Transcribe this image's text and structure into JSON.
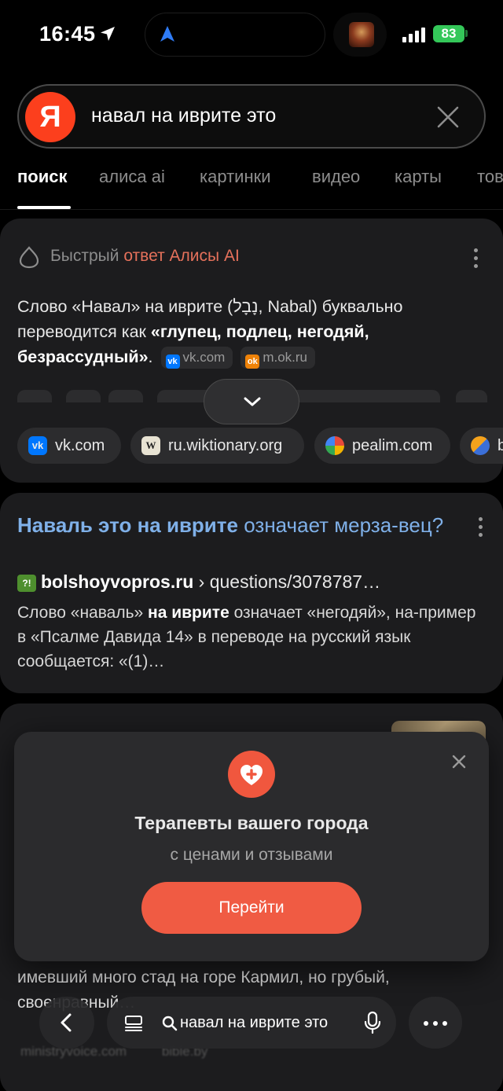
{
  "status_bar": {
    "time": "16:45",
    "battery": "83"
  },
  "search": {
    "logo_letter": "Я",
    "query": "навал на иврите это"
  },
  "tabs": [
    {
      "label": "поиск",
      "active": true
    },
    {
      "label": "алиса ai",
      "active": false
    },
    {
      "label": "картинки",
      "active": false
    },
    {
      "label": "видео",
      "active": false
    },
    {
      "label": "карты",
      "active": false
    },
    {
      "label": "тов",
      "active": false
    }
  ],
  "ai_answer": {
    "label_prefix": "Быстрый",
    "label_accent": "ответ Алисы AI",
    "text_part1": "Слово «Навал» на иврите (נָבָל, Nabal) буквально переводится как ",
    "text_bold": "«глупец, подлец, негодяй, безрассудный»",
    "text_end": ".",
    "inline_sources": [
      {
        "name": "vk.com",
        "icon": "vk-icon"
      },
      {
        "name": "m.ok.ru",
        "icon": "odnoklassniki-icon"
      }
    ],
    "sources": [
      {
        "name": "vk.com",
        "icon": "vk-icon"
      },
      {
        "name": "ru.wiktionary.org",
        "icon": "wikipedia-icon"
      },
      {
        "name": "pealim.com",
        "icon": "pealim-icon"
      },
      {
        "name": "b",
        "icon": "bible-icon"
      }
    ]
  },
  "result1": {
    "title_part1": "Наваль это на иврите",
    "title_part2": " означает мерза-вец?",
    "domain": "bolshoyvopros.ru",
    "path": " › questions/3078787…",
    "snippet_1": "Слово «наваль» ",
    "snippet_bold": "на иврите",
    "snippet_2": " означает «негодяй», на-пример в «Псалме Давида 14» в переводе на русский язык сообщается: «(1)…"
  },
  "result2": {
    "text": "имевший много стад на горе Кармил, но грубый, своенравный…",
    "sources": [
      "ministryvoice.com",
      "bible.by"
    ]
  },
  "popup": {
    "title": "Терапевты вашего города",
    "subtitle": "с ценами и отзывами",
    "button": "Перейти"
  },
  "bottom_bar": {
    "query": "навал на иврите это"
  },
  "colors": {
    "brand_red": "#fc3f1d",
    "link_blue": "#7fb0e8",
    "alice_accent": "#e5715b",
    "cta": "#f05b43"
  }
}
